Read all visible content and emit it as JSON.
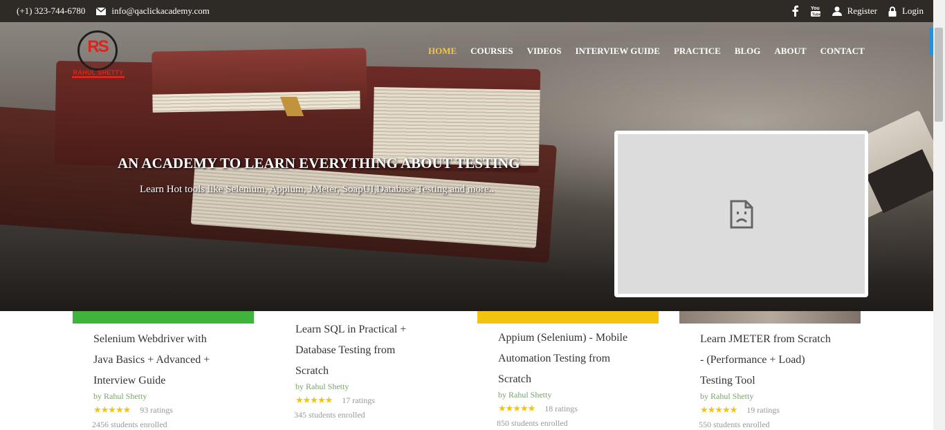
{
  "topbar": {
    "phone": "(+1) 323-744-6780",
    "email": "info@qaclickacademy.com",
    "register": "Register",
    "login": "Login"
  },
  "logo": {
    "text": "RS",
    "name": "RAHUL SHETTY"
  },
  "nav": [
    "HOME",
    "COURSES",
    "VIDEOS",
    "INTERVIEW GUIDE",
    "PRACTICE",
    "BLOG",
    "ABOUT",
    "CONTACT"
  ],
  "hero": {
    "title": "AN ACADEMY TO LEARN EVERYTHING ABOUT TESTING",
    "subtitle": "Learn Hot tools like Selenium, Appium, JMeter, SoapUI,Database Testing and more.."
  },
  "courses": [
    {
      "title_lines": [
        "Selenium Webdriver with",
        "Java Basics + Advanced +",
        "Interview Guide"
      ],
      "author": "by Rahul Shetty",
      "stars": "★★★★★",
      "ratings": "93 ratings",
      "students": "2456 students enrolled",
      "thumb_color": "#3fb33a"
    },
    {
      "title_lines": [
        "Learn SQL in Practical +",
        "Database Testing from",
        "Scratch"
      ],
      "author": "by Rahul Shetty",
      "stars": "★★★★★",
      "ratings": "17 ratings",
      "students": "345 students enrolled",
      "thumb_color": "#ffffff"
    },
    {
      "title_lines": [
        "Appium (Selenium) - Mobile",
        "Automation Testing from",
        "Scratch"
      ],
      "author": "by Rahul Shetty",
      "stars": "★★★★★",
      "ratings": "18 ratings",
      "students": "850 students enrolled",
      "thumb_color": "#f2c311"
    },
    {
      "title_lines": [
        "Learn JMETER from Scratch",
        "- (Performance + Load)",
        "Testing Tool"
      ],
      "author": "by Rahul Shetty",
      "stars": "★★★★★",
      "ratings": "19 ratings",
      "students": "550 students enrolled",
      "thumb_color": "#9c8f84"
    }
  ]
}
